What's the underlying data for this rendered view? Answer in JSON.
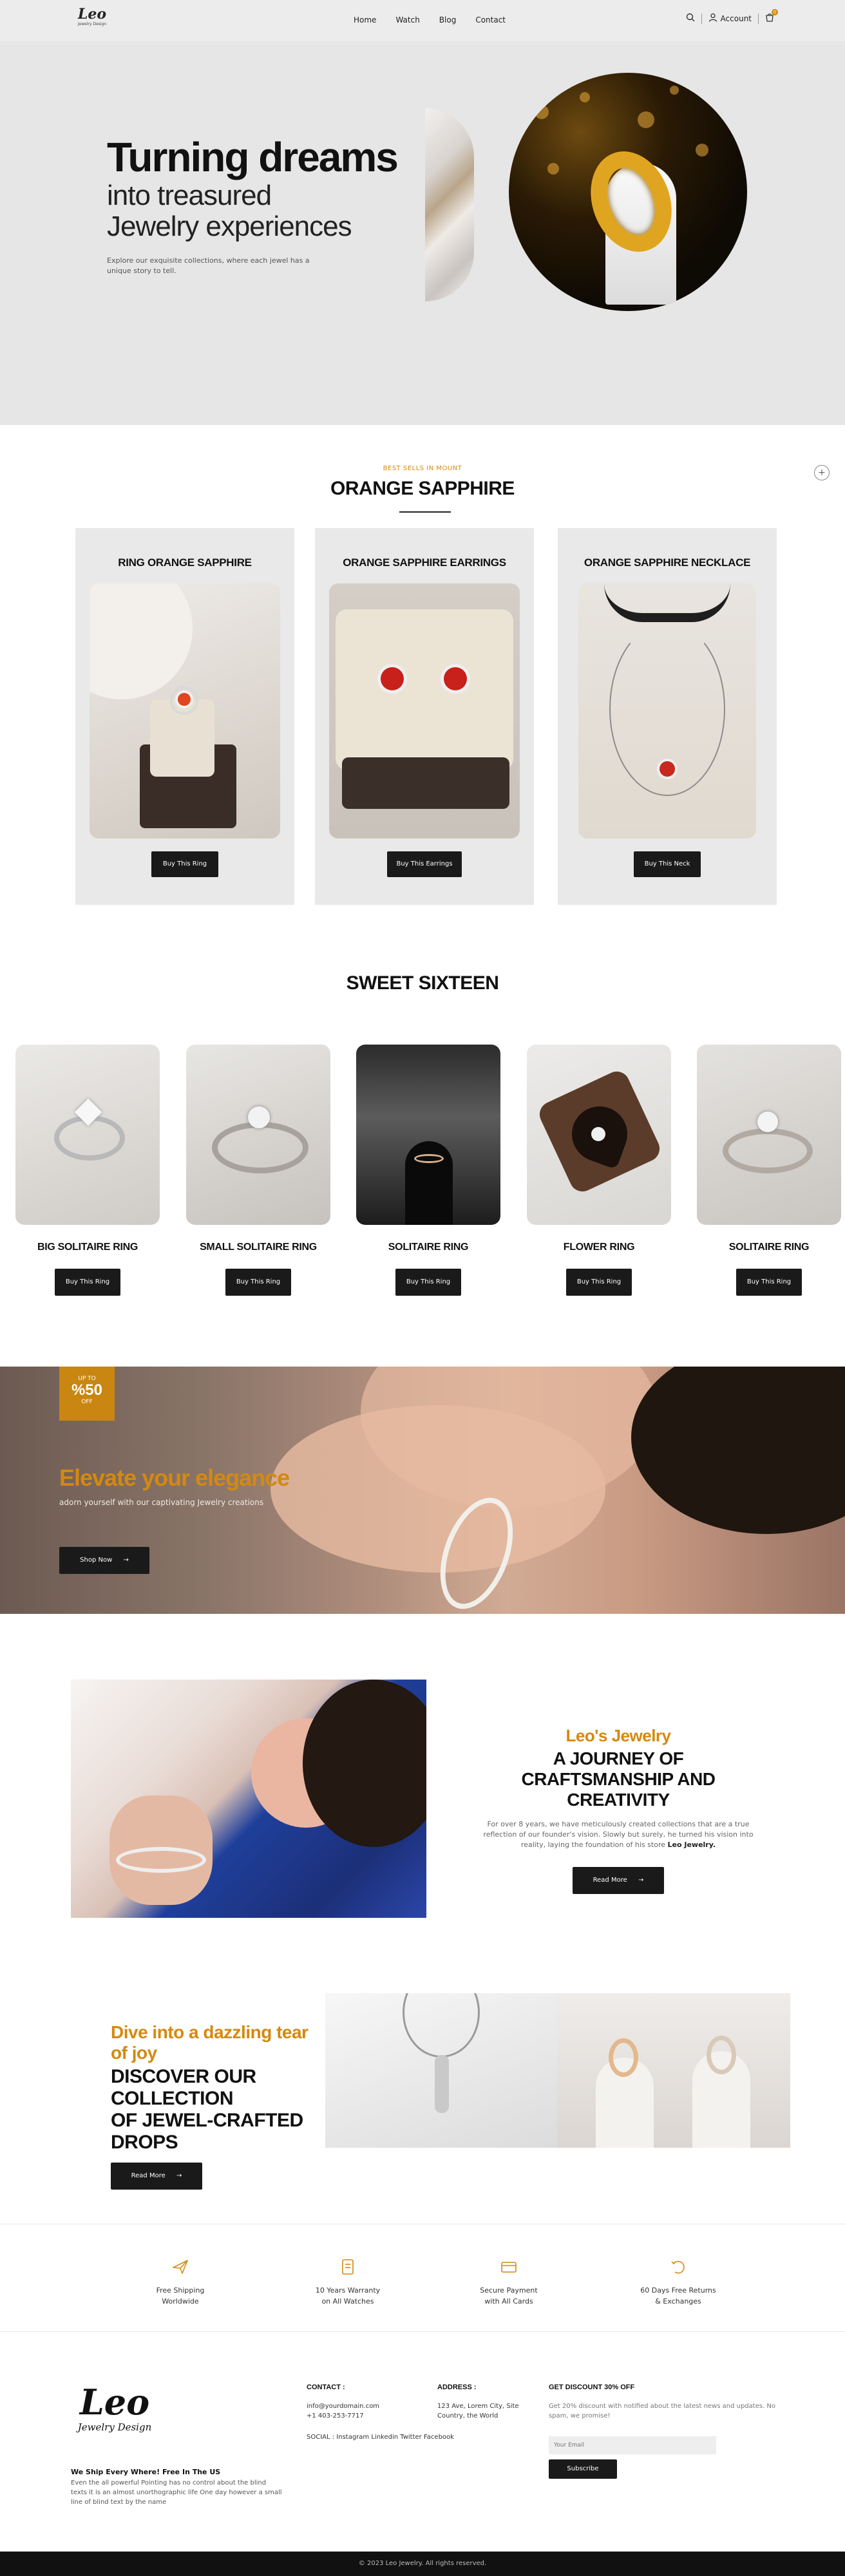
{
  "header": {
    "logo_mark": "Leo",
    "logo_sub": "Jewelry Design",
    "nav": [
      "Home",
      "Watch",
      "Blog",
      "Contact"
    ],
    "account_label": "Account",
    "cart_count": "0"
  },
  "hero": {
    "title_line1": "Turning dreams",
    "title_line2": "into treasured",
    "title_line3": "Jewelry experiences",
    "description": "Explore our exquisite collections, where each jewel has a unique story to tell."
  },
  "orange_sapphire": {
    "eyebrow": "BEST SELLS IN MOUNT",
    "title": "ORANGE SAPPHIRE",
    "cards": [
      {
        "title": "RING ORANGE SAPPHIRE",
        "button": "Buy This Ring"
      },
      {
        "title": "ORANGE SAPPHIRE EARRINGS",
        "button": "Buy This Earrings"
      },
      {
        "title": "ORANGE SAPPHIRE NECKLACE",
        "button": "Buy This Neck"
      }
    ]
  },
  "sweet_sixteen": {
    "title": "SWEET SIXTEEN",
    "items": [
      {
        "title": "BIG SOLITAIRE RING",
        "button": "Buy This Ring"
      },
      {
        "title": "SMALL SOLITAIRE RING",
        "button": "Buy This Ring"
      },
      {
        "title": "SOLITAIRE RING",
        "button": "Buy This Ring"
      },
      {
        "title": "FLOWER RING",
        "button": "Buy This Ring"
      },
      {
        "title": "SOLITAIRE RING",
        "button": "Buy This Ring"
      }
    ]
  },
  "promo": {
    "badge_top": "UP TO",
    "badge_value": "%50",
    "badge_bottom": "OFF",
    "title": "Elevate your elegance",
    "subtitle": "adorn yourself with our captivating Jewelry creations",
    "button": "Shop Now"
  },
  "journey": {
    "eyebrow": "Leo's Jewelry",
    "title_line1": "A JOURNEY OF",
    "title_line2": "CRAFTSMANSHIP AND CREATIVITY",
    "text": "For over 8 years, we have meticulously created collections that are a true reflection of our founder's vision. Slowly but surely, he turned his vision into reality, laying the foundation of his store",
    "text_strong": "Leo Jewelry.",
    "button": "Read More"
  },
  "collection": {
    "eyebrow": "Dive into a dazzling tear of joy",
    "title_line1": "DISCOVER OUR COLLECTION",
    "title_line2": "OF JEWEL-CRAFTED DROPS",
    "button": "Read More"
  },
  "features": [
    {
      "icon": "plane-icon",
      "line1": "Free Shipping",
      "line2": "Worldwide"
    },
    {
      "icon": "warranty-icon",
      "line1": "10 Years Warranty",
      "line2": "on All Watches"
    },
    {
      "icon": "card-icon",
      "line1": "Secure Payment",
      "line2": "with All Cards"
    },
    {
      "icon": "return-icon",
      "line1": "60 Days Free Returns",
      "line2": "& Exchanges"
    }
  ],
  "footer": {
    "logo_mark": "Leo",
    "logo_sub": "Jewelry Design",
    "ship_heading": "We Ship Every Where! Free In The US",
    "ship_text": "Even the all powerful Pointing has no control about the blind texts it is an almost unorthographic life One day however a small line of blind text by the name",
    "contact_heading": "CONTACT :",
    "email": "info@yourdomain.com",
    "phone": "+1 403-253-7717",
    "social": "SOCIAL : Instagram Linkedin Twitter Facebook",
    "address_heading": "ADDRESS :",
    "address_line1": "123 Ave, Lorem City, Site",
    "address_line2": "Country, the World",
    "discount_heading": "GET DISCOUNT 30% OFF",
    "discount_text": "Get 20% discount with notified about the latest news and updates. No spam, we promise!",
    "email_placeholder": "Your Email",
    "subscribe": "Subscribe",
    "copyright": "© 2023 Leo Jewelry. All rights reserved."
  },
  "colors": {
    "accent": "#d4890f",
    "dark": "#1a1a1a",
    "hero_bg": "#e6e6e6",
    "card_bg": "#e9e9e9"
  }
}
